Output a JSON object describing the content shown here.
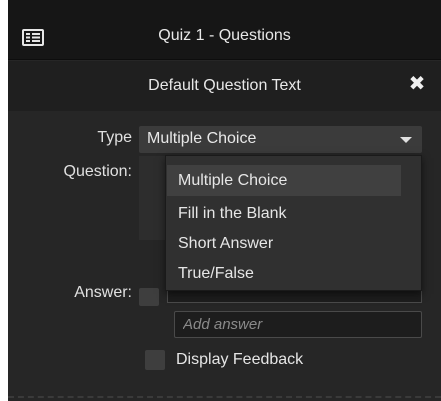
{
  "window": {
    "title": "Quiz 1 - Questions",
    "menu_icon": "list-menu-icon"
  },
  "question_header": {
    "title": "Default Question Text",
    "close_icon": "close-icon",
    "close_glyph": "✖"
  },
  "form": {
    "type_label": "Type",
    "type_value": "Multiple Choice",
    "question_label": "Question:",
    "answer_label": "Answer:",
    "add_answer_placeholder": "Add answer",
    "display_feedback_label": "Display Feedback",
    "display_feedback_checked": false
  },
  "type_dropdown": {
    "open": true,
    "selected": "Multiple Choice",
    "options": [
      "Multiple Choice",
      "Fill in the Blank",
      "Short Answer",
      "True/False"
    ]
  },
  "colors": {
    "panel_bg": "#262626",
    "title_bar_bg": "#161616",
    "text": "#e8e8e8",
    "dropdown_bg": "#303030",
    "dropdown_highlight": "#404040"
  }
}
